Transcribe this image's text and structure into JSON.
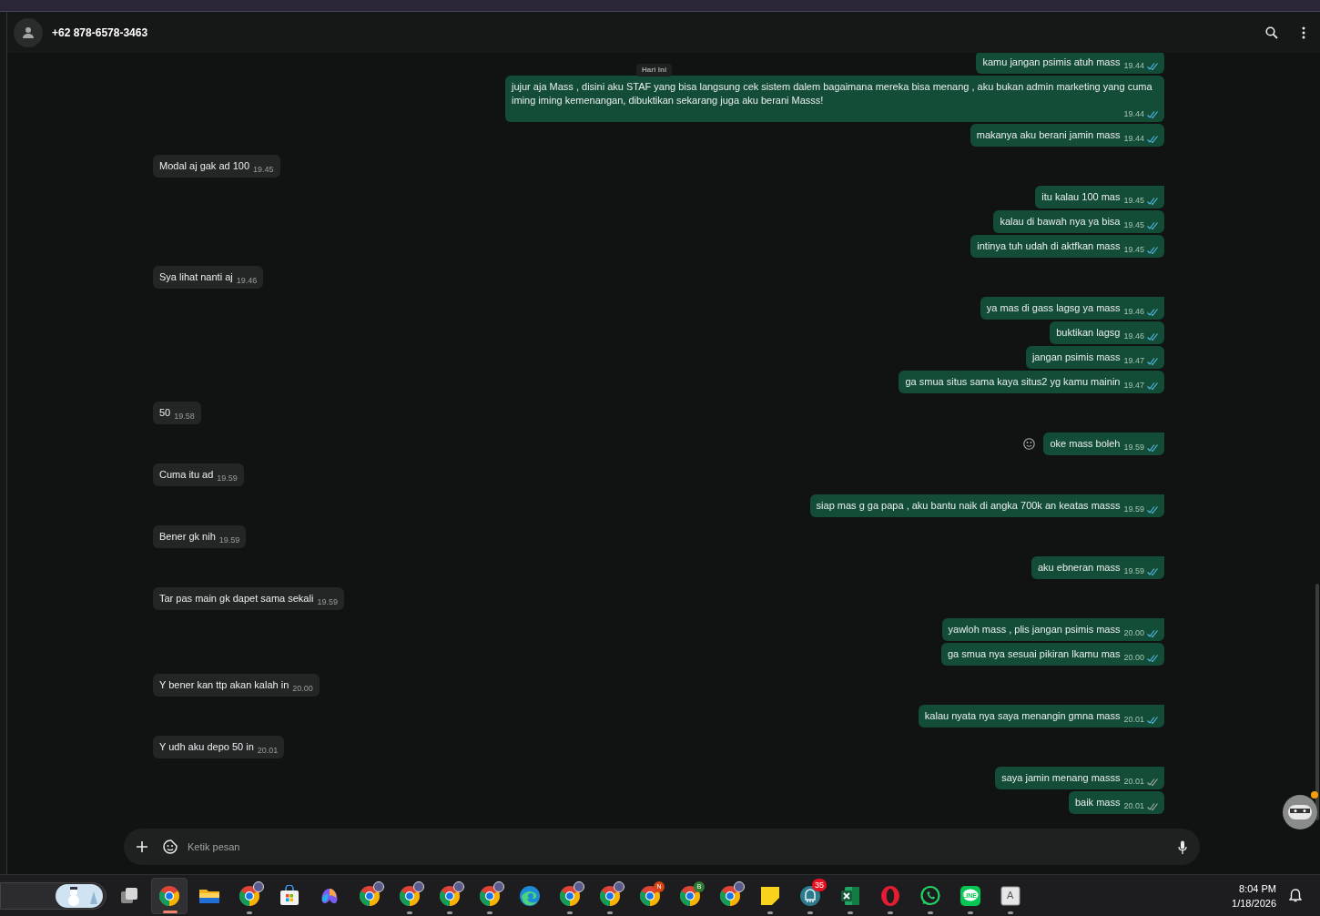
{
  "chat_header": {
    "contact": "+62 878-6578-3463"
  },
  "date_chip": "Hari Ini",
  "messages": [
    {
      "kind": "out",
      "text": "kamu jangan psimis atuh mass",
      "time": "19.44",
      "read": true,
      "tail": false,
      "react_icon": false
    },
    {
      "kind": "out",
      "text": "jujur aja Mass , disini aku STAF yang bisa langsung cek sistem dalem bagaimana mereka bisa menang , aku bukan admin marketing yang cuma iming iming kemenangan, dibuktikan sekarang juga aku berani Masss!",
      "time": "19.44",
      "read": true,
      "tail": false,
      "react_icon": false
    },
    {
      "kind": "out",
      "text": "makanya aku berani jamin mass",
      "time": "19.44",
      "read": true,
      "tail": false,
      "react_icon": false
    },
    {
      "kind": "in",
      "text": "Modal aj gak ad 100",
      "time": "19.45",
      "tail": false,
      "react_icon": false
    },
    {
      "kind": "out",
      "text": "itu kalau 100 mas",
      "time": "19.45",
      "read": true,
      "tail": true,
      "react_icon": false
    },
    {
      "kind": "out",
      "text": "kalau di bawah nya ya bisa",
      "time": "19.45",
      "read": true,
      "tail": false,
      "react_icon": false
    },
    {
      "kind": "out",
      "text": "intinya tuh udah di aktfkan mass",
      "time": "19.45",
      "read": true,
      "tail": false,
      "react_icon": false
    },
    {
      "kind": "in",
      "text": "Sya lihat nanti aj",
      "time": "19.46",
      "tail": false,
      "react_icon": false
    },
    {
      "kind": "out",
      "text": "ya mas di gass lagsg ya mass",
      "time": "19.46",
      "read": true,
      "tail": true,
      "react_icon": false
    },
    {
      "kind": "out",
      "text": "buktikan lagsg",
      "time": "19.46",
      "read": true,
      "tail": false,
      "react_icon": false
    },
    {
      "kind": "out",
      "text": "jangan psimis mass",
      "time": "19.47",
      "read": true,
      "tail": false,
      "react_icon": false
    },
    {
      "kind": "out",
      "text": "ga smua situs sama kaya situs2 yg kamu mainin",
      "time": "19.47",
      "read": true,
      "tail": false,
      "react_icon": false
    },
    {
      "kind": "in",
      "text": "50",
      "time": "19.58",
      "tail": false,
      "react_icon": false
    },
    {
      "kind": "out",
      "text": "oke mass boleh",
      "time": "19.59",
      "read": true,
      "tail": true,
      "react_icon": true
    },
    {
      "kind": "in",
      "text": "Cuma itu ad",
      "time": "19.59",
      "tail": false,
      "react_icon": false
    },
    {
      "kind": "out",
      "text": "siap mas g ga papa , aku bantu naik di angka 700k an keatas masss",
      "time": "19.59",
      "read": true,
      "tail": true,
      "react_icon": false
    },
    {
      "kind": "in",
      "text": "Bener gk nih",
      "time": "19.59",
      "tail": false,
      "react_icon": false
    },
    {
      "kind": "out",
      "text": "aku ebneran mass",
      "time": "19.59",
      "read": true,
      "tail": true,
      "react_icon": false
    },
    {
      "kind": "in",
      "text": "Tar pas main gk dapet sama sekali",
      "time": "19.59",
      "tail": false,
      "react_icon": false
    },
    {
      "kind": "out",
      "text": "yawloh mass , plis jangan psimis mass",
      "time": "20.00",
      "read": true,
      "tail": true,
      "react_icon": false
    },
    {
      "kind": "out",
      "text": "ga smua nya sesuai pikiran lkamu mas",
      "time": "20.00",
      "read": true,
      "tail": false,
      "react_icon": false
    },
    {
      "kind": "in",
      "text": "Y bener kan ttp akan kalah in",
      "time": "20.00",
      "tail": false,
      "react_icon": false
    },
    {
      "kind": "out",
      "text": "kalau nyata nya saya menangin gmna mass",
      "time": "20.01",
      "read": true,
      "tail": true,
      "react_icon": false
    },
    {
      "kind": "in",
      "text": "Y udh aku depo 50 in",
      "time": "20.01",
      "tail": false,
      "react_icon": false
    },
    {
      "kind": "out",
      "text": "saya jamin menang masss",
      "time": "20.01",
      "read": false,
      "tail": true,
      "react_icon": false
    },
    {
      "kind": "out",
      "text": "baik mass",
      "time": "20.01",
      "read": false,
      "tail": false,
      "react_icon": false
    }
  ],
  "composer": {
    "placeholder": "Ketik pesan"
  },
  "taskbar": {
    "items": [
      {
        "kind": "taskview",
        "selected": false,
        "running": false
      },
      {
        "kind": "chrome",
        "selected": true,
        "running": true
      },
      {
        "kind": "folder",
        "selected": false,
        "running": false
      },
      {
        "kind": "chrome",
        "profile": true,
        "selected": false,
        "running": true
      },
      {
        "kind": "store",
        "selected": false,
        "running": false
      },
      {
        "kind": "copilot",
        "selected": false,
        "running": false
      },
      {
        "kind": "chrome",
        "profile": true,
        "selected": false,
        "running": false
      },
      {
        "kind": "chrome",
        "profile": true,
        "selected": false,
        "running": true
      },
      {
        "kind": "chrome",
        "profile": true,
        "selected": false,
        "running": true
      },
      {
        "kind": "chrome",
        "profile": true,
        "selected": false,
        "running": true
      },
      {
        "kind": "edge",
        "selected": false,
        "running": false
      },
      {
        "kind": "chrome",
        "profile": true,
        "selected": false,
        "running": true
      },
      {
        "kind": "chrome",
        "profile": true,
        "selected": false,
        "running": true
      },
      {
        "kind": "chrome",
        "badge": "N",
        "selected": false,
        "running": false
      },
      {
        "kind": "chrome",
        "badge": "B",
        "selected": false,
        "running": false
      },
      {
        "kind": "chrome",
        "profile": true,
        "selected": false,
        "running": false
      },
      {
        "kind": "sticky",
        "selected": false,
        "running": true
      },
      {
        "kind": "app",
        "count": "35",
        "selected": false,
        "running": true
      },
      {
        "kind": "excel",
        "selected": false,
        "running": true
      },
      {
        "kind": "opera",
        "selected": false,
        "running": true
      },
      {
        "kind": "whatsapp",
        "selected": false,
        "running": true
      },
      {
        "kind": "line",
        "label": "LINE",
        "selected": false,
        "running": true
      },
      {
        "kind": "letter",
        "label": "A",
        "selected": false,
        "running": true
      }
    ],
    "time": "8:04 PM",
    "date": "1/18/2026"
  }
}
